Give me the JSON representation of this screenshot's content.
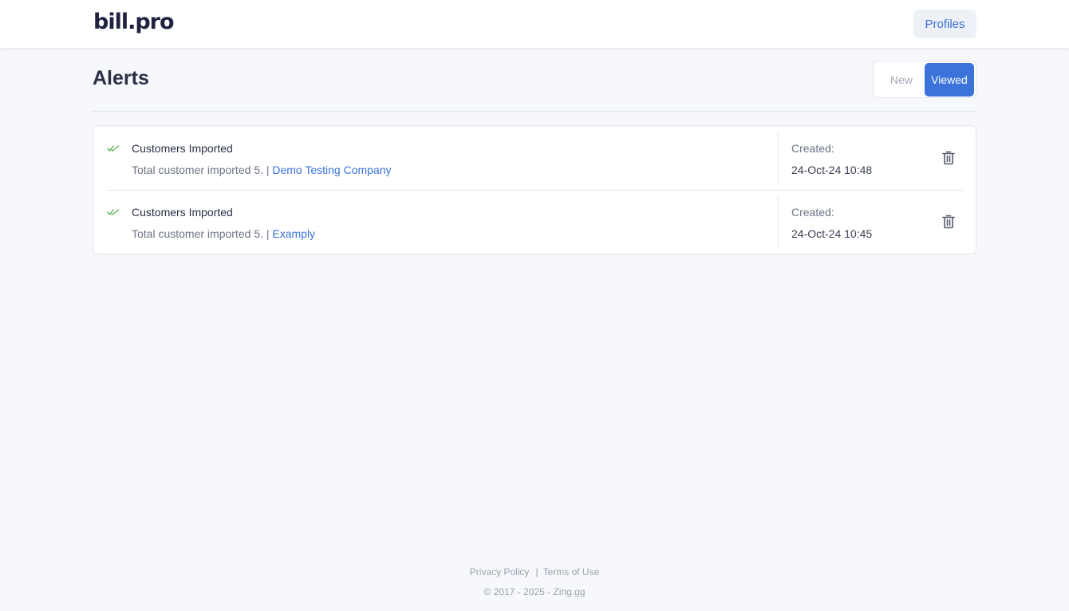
{
  "header": {
    "logo_text": "bill.pro",
    "profiles_label": "Profiles"
  },
  "page": {
    "title": "Alerts"
  },
  "filter_toggle": {
    "options": [
      "New",
      "Viewed"
    ],
    "selected": "Viewed"
  },
  "alerts": [
    {
      "title": "Customers Imported",
      "description": "Total customer imported 5. | ",
      "link_text": "Demo Testing Company",
      "created_label": "Created:",
      "created_date": "24-Oct-24 10:48",
      "icon": "double-check-icon"
    },
    {
      "title": "Customers Imported",
      "description": "Total customer imported 5. | ",
      "link_text": "Examply",
      "created_label": "Created:",
      "created_date": "24-Oct-24 10:45",
      "icon": "double-check-icon"
    }
  ],
  "footer": {
    "privacy_label": "Privacy Policy",
    "separator": "|",
    "terms_label": "Terms of Use",
    "copyright": "© 2017 - 2025 - Zing.gg"
  },
  "colors": {
    "accent": "#3b73db",
    "check": "#5cb85c",
    "background": "#f7f8fb"
  }
}
